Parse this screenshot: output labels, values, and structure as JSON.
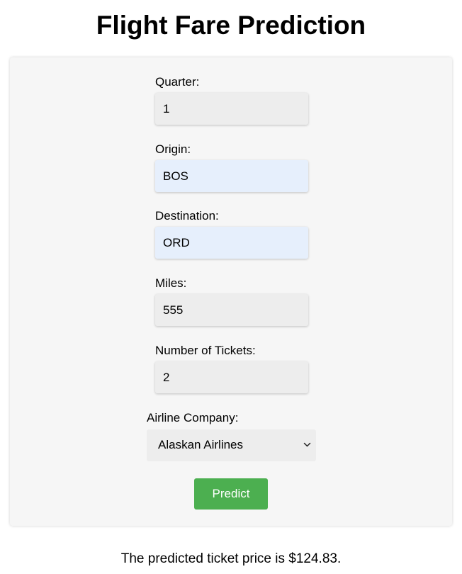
{
  "page_title": "Flight Fare Prediction",
  "form": {
    "quarter": {
      "label": "Quarter:",
      "value": "1"
    },
    "origin": {
      "label": "Origin:",
      "value": "BOS"
    },
    "destination": {
      "label": "Destination:",
      "value": "ORD"
    },
    "miles": {
      "label": "Miles:",
      "value": "555"
    },
    "tickets": {
      "label": "Number of Tickets:",
      "value": "2"
    },
    "airline": {
      "label": "Airline Company:",
      "selected": "Alaskan Airlines"
    },
    "submit_label": "Predict"
  },
  "result_text": "The predicted ticket price is $124.83.",
  "colors": {
    "button": "#4caf50",
    "card_background": "#f6f6f6",
    "autofill_background": "#e6effc",
    "input_background": "#ededed"
  },
  "icons": {
    "select_arrow": "chevron-down-icon"
  }
}
